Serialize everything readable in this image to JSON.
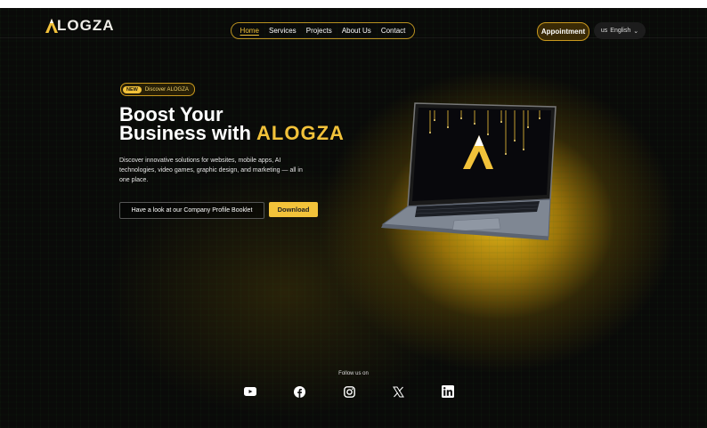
{
  "logo": {
    "text": "LOGZA"
  },
  "nav": {
    "items": [
      {
        "label": "Home",
        "active": true
      },
      {
        "label": "Services"
      },
      {
        "label": "Projects"
      },
      {
        "label": "About Us"
      },
      {
        "label": "Contact"
      }
    ],
    "appointment_label": "Appointment",
    "language": {
      "flag": "us",
      "label": "English"
    }
  },
  "hero": {
    "badge_new": "NEW",
    "badge_text": "Discover ALOGZA",
    "title_line1": "Boost Your",
    "title_line2_prefix": "Business with ",
    "title_brand": "ALOGZA",
    "description": "Discover innovative solutions for websites, mobile apps, AI technologies, video games, graphic design, and marketing — all in one place.",
    "profile_button": "Have a look at our Company Profile Booklet",
    "download_button": "Download"
  },
  "footer": {
    "follow_label": "Follow us on",
    "socials": [
      "youtube-icon",
      "facebook-icon",
      "instagram-icon",
      "x-icon",
      "linkedin-icon"
    ]
  },
  "colors": {
    "accent": "#f2c23a",
    "background": "#0b0b0a"
  }
}
